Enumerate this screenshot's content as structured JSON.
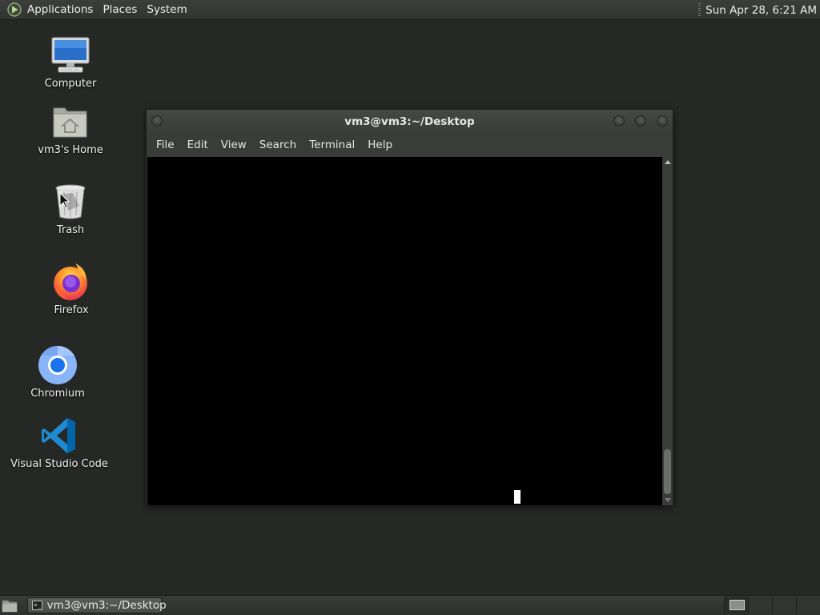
{
  "top_panel": {
    "menu": [
      "Applications",
      "Places",
      "System"
    ],
    "clock": "Sun Apr 28,  6:21 AM"
  },
  "desktop_icons": [
    {
      "label": "Computer",
      "icon": "computer-icon"
    },
    {
      "label": "vm3's Home",
      "icon": "home-folder-icon"
    },
    {
      "label": "Trash",
      "icon": "trash-icon"
    },
    {
      "label": "Firefox",
      "icon": "firefox-icon"
    },
    {
      "label": "Chromium",
      "icon": "chromium-icon"
    },
    {
      "label": "Visual Studio Code",
      "icon": "vscode-icon"
    }
  ],
  "terminal": {
    "title": "vm3@vm3:~/Desktop",
    "menu": [
      "File",
      "Edit",
      "View",
      "Search",
      "Terminal",
      "Help"
    ]
  },
  "taskbar": {
    "task_label": "vm3@vm3:~/Desktop",
    "workspace_count": 4,
    "active_workspace": 1
  },
  "colors": {
    "desktop_background": "#262826",
    "terminal_background": "#000000",
    "cursor": "#ffffff"
  }
}
